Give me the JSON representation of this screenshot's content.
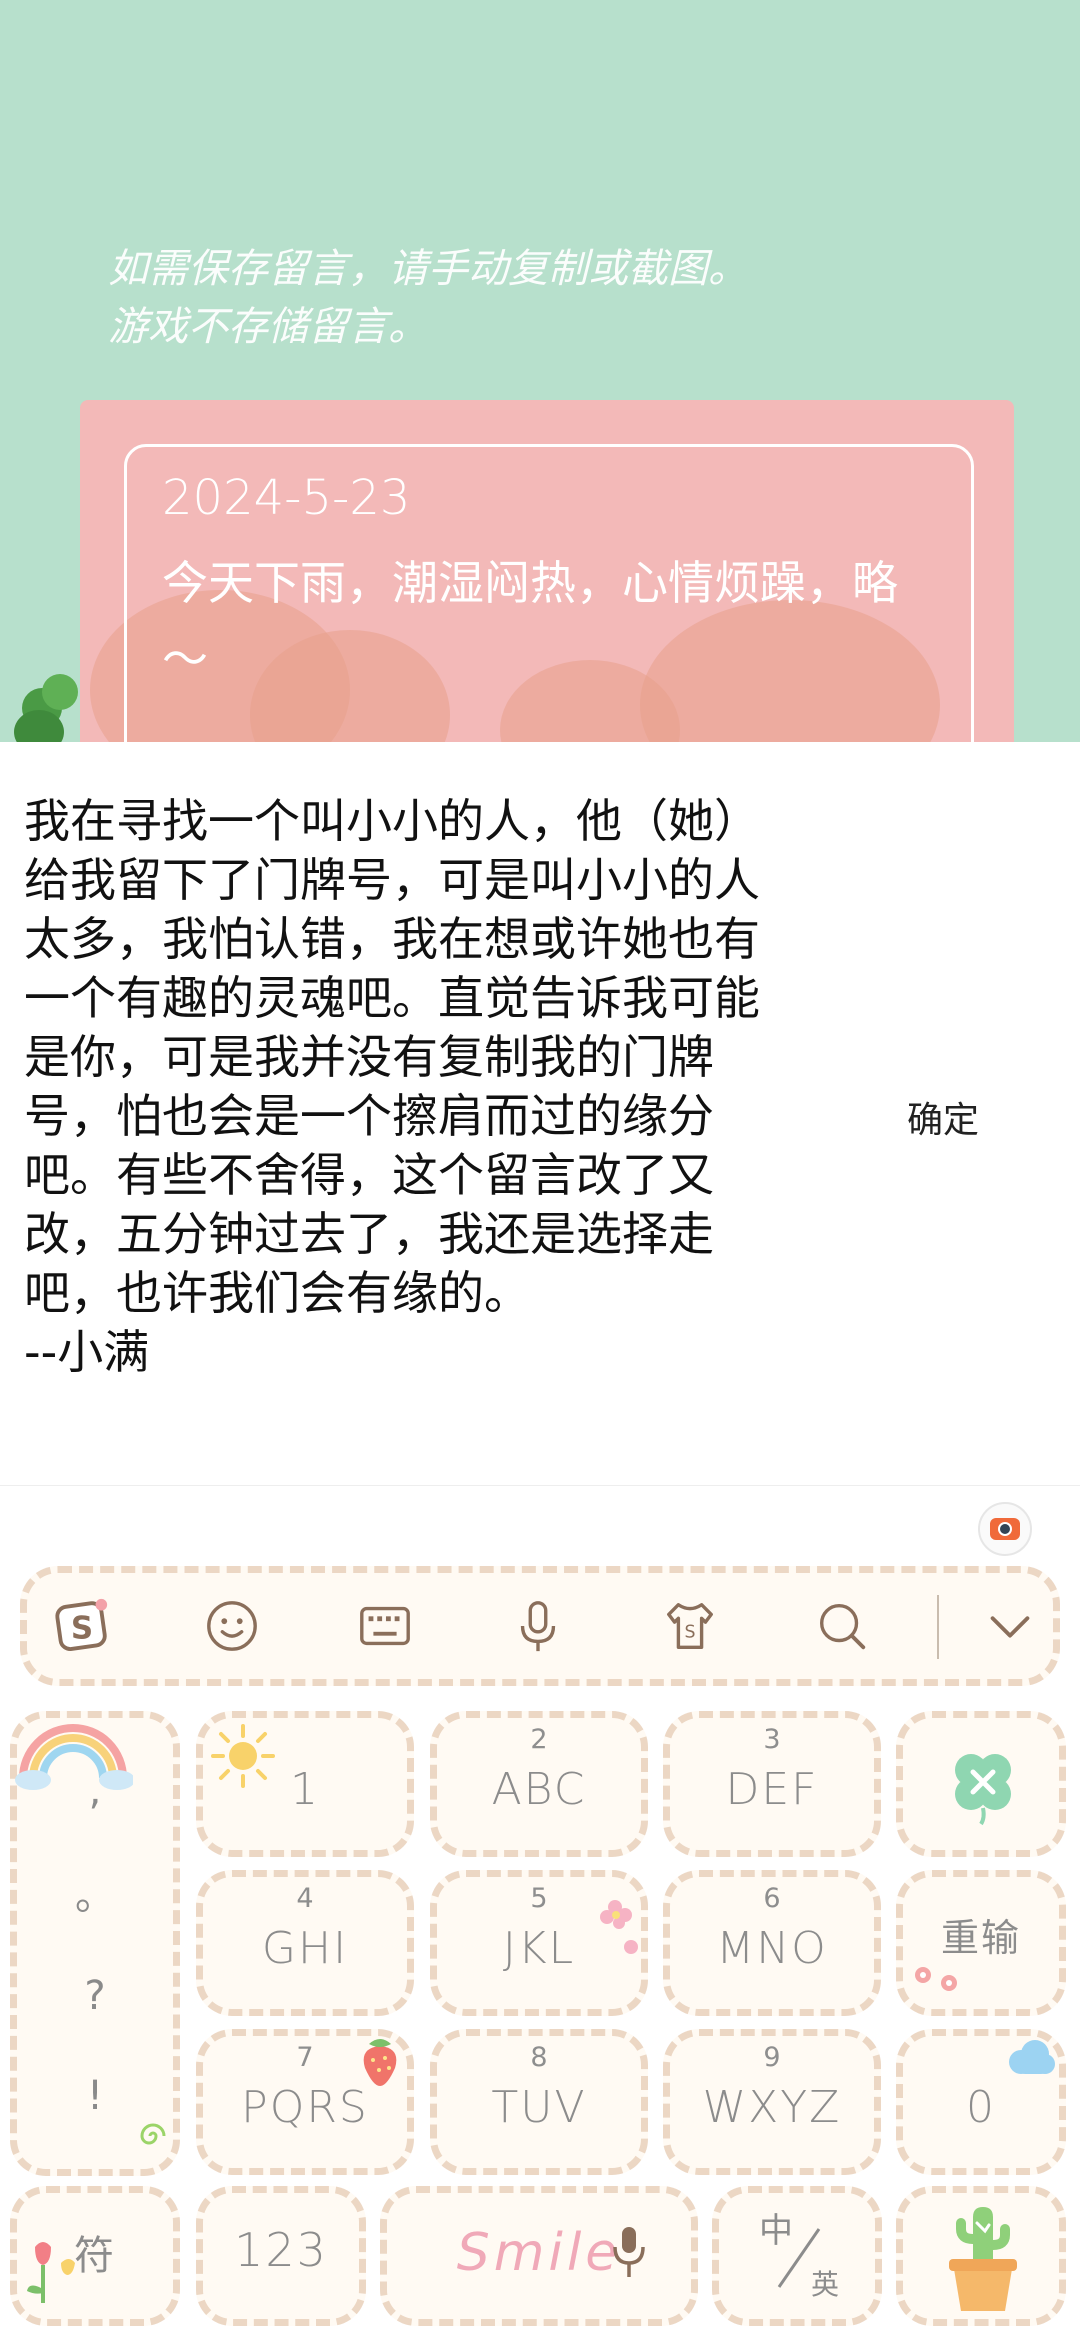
{
  "game": {
    "notice_lines": [
      "如需保存留言，请手动复制或截图。",
      "游戏不存储留言。"
    ],
    "card_date": "2024-5-23",
    "card_text": "今天下雨，潮湿闷热，心情烦躁，略～"
  },
  "input": {
    "message": "我在寻找一个叫小小的人，他（她）给我留下了门牌号，可是叫小小的人太多，我怕认错，我在想或许她也有一个有趣的灵魂吧。直觉告诉我可能是你，可是我并没有复制我的门牌号，怕也会是一个擦肩而过的缘分吧。有些不舍得，这个留言改了又改，五分钟过去了，我还是选择走吧，也许我们会有缘的。\n--小满",
    "confirm_label": "确定"
  },
  "keyboard": {
    "toolbar_icons": [
      "sogou-logo-icon",
      "emoji-icon",
      "keyboard-icon",
      "microphone-icon",
      "skin-shirt-icon",
      "search-icon",
      "collapse-chevron-icon"
    ],
    "punctuation": [
      ",",
      "。",
      "?",
      "!"
    ],
    "keys": [
      {
        "num": "",
        "label": "1"
      },
      {
        "num": "2",
        "label": "ABC"
      },
      {
        "num": "3",
        "label": "DEF"
      },
      {
        "num": "4",
        "label": "GHI"
      },
      {
        "num": "5",
        "label": "JKL"
      },
      {
        "num": "6",
        "label": "MNO"
      },
      {
        "num": "7",
        "label": "PQRS"
      },
      {
        "num": "8",
        "label": "TUV"
      },
      {
        "num": "9",
        "label": "WXYZ"
      }
    ],
    "retype_label": "重输",
    "zero_label": "0",
    "symbol_label": "符",
    "num_label": "123",
    "space_label": "Smile",
    "lang_label_top": "中",
    "lang_label_bottom": "英"
  }
}
